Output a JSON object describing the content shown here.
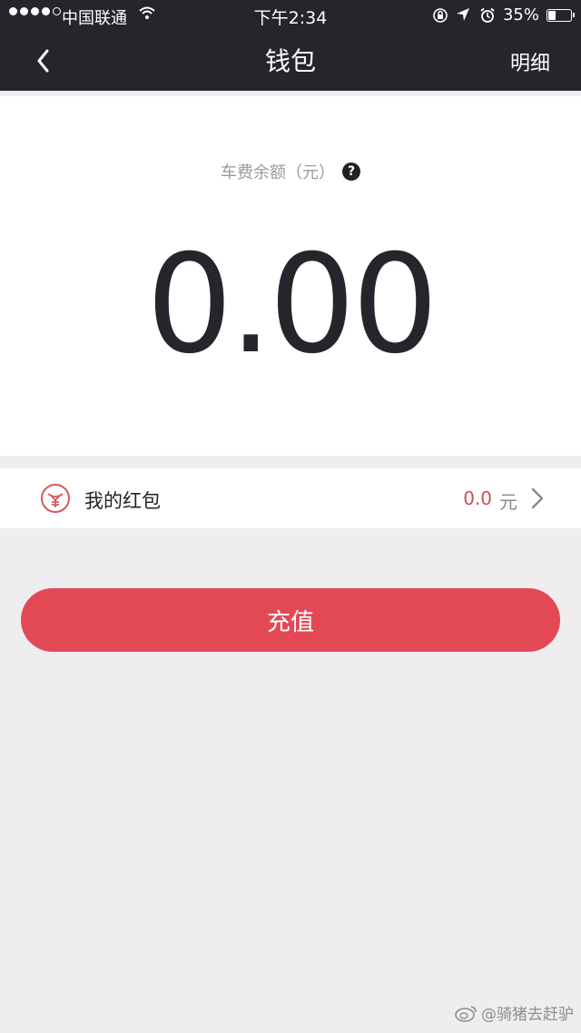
{
  "status_bar": {
    "carrier": "中国联通",
    "time": "下午2:34",
    "battery": "35%",
    "battery_level": 0.35
  },
  "nav": {
    "title": "钱包",
    "detail_label": "明细"
  },
  "balance": {
    "label": "车费余额（元）",
    "help_glyph": "?",
    "amount": "0.00"
  },
  "red_packet": {
    "label": "我的红包",
    "value": "0.0",
    "unit": "元"
  },
  "recharge": {
    "label": "充值"
  },
  "watermark": {
    "text": "@骑猪去赶驴"
  },
  "colors": {
    "nav_bg": "#26252c",
    "accent": "#e34855",
    "page_bg": "#efedef"
  }
}
